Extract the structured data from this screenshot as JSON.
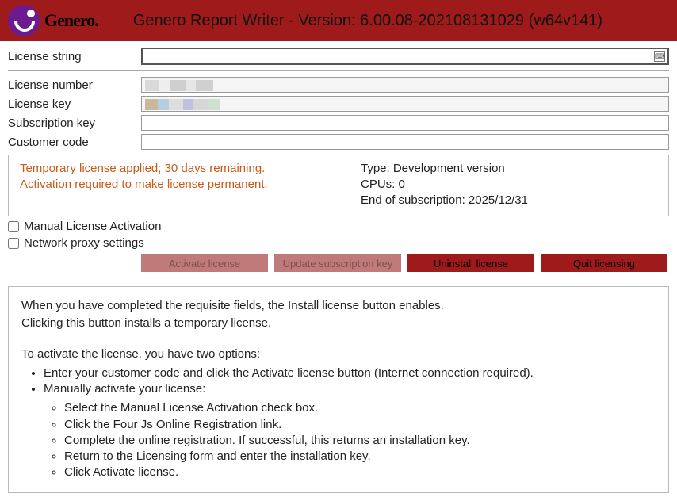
{
  "header": {
    "brand": "Genero.",
    "title": "Genero Report Writer - Version: 6.00.08-202108131029 (w64v141)"
  },
  "form": {
    "license_string_label": "License string",
    "license_string_value": "",
    "license_number_label": "License number",
    "license_number_value": "",
    "license_key_label": "License key",
    "license_key_value": "",
    "subscription_key_label": "Subscription key",
    "subscription_key_value": "",
    "customer_code_label": "Customer code",
    "customer_code_value": ""
  },
  "status": {
    "line1": "Temporary license applied; 30 days remaining.",
    "line2": "Activation required to make license permanent.",
    "type": "Type: Development version",
    "cpus": "CPUs: 0",
    "end": "End of subscription: 2025/12/31"
  },
  "checks": {
    "manual_label": "Manual License Activation",
    "proxy_label": "Network proxy settings"
  },
  "buttons": {
    "activate": "Activate license",
    "update": "Update subscription key",
    "uninstall": "Uninstall license",
    "quit": "Quit licensing"
  },
  "help": {
    "p1": "When you have completed the requisite fields, the Install license button enables.",
    "p2": "Clicking this button installs a temporary license.",
    "p3": "To activate the license, you have two options:",
    "opt1": "Enter your customer code and click the Activate license button (Internet connection required).",
    "opt2": "Manually activate your license:",
    "sub1": "Select the Manual License Activation check box.",
    "sub2": "Click the Four Js Online Registration link.",
    "sub3": "Complete the online registration. If successful, this returns an installation key.",
    "sub4": "Return to the Licensing form and enter the installation key.",
    "sub5": "Click Activate license."
  }
}
